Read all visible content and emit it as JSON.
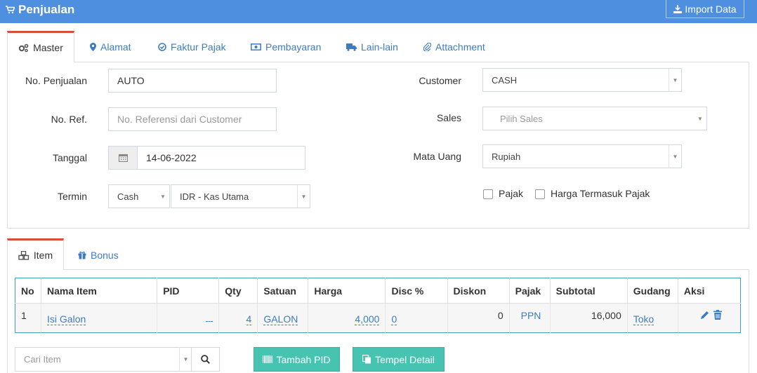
{
  "header": {
    "title": "Penjualan",
    "import_label": "Import Data"
  },
  "master_tabs": [
    "Master",
    "Alamat",
    "Faktur Pajak",
    "Pembayaran",
    "Lain-lain",
    "Attachment"
  ],
  "form": {
    "no_penjualan": {
      "label": "No. Penjualan",
      "value": "AUTO"
    },
    "no_ref": {
      "label": "No. Ref.",
      "placeholder": "No. Referensi dari Customer"
    },
    "tanggal": {
      "label": "Tanggal",
      "value": "14-06-2022"
    },
    "termin": {
      "label": "Termin",
      "value": "Cash",
      "account": "IDR - Kas Utama"
    },
    "customer": {
      "label": "Customer",
      "value": "CASH"
    },
    "sales": {
      "label": "Sales",
      "placeholder": "Pilih Sales"
    },
    "mata_uang": {
      "label": "Mata Uang",
      "value": "Rupiah"
    },
    "pajak_label": "Pajak",
    "harga_termasuk_pajak_label": "Harga Termasuk Pajak"
  },
  "item_tabs": [
    "Item",
    "Bonus"
  ],
  "table": {
    "headers": [
      "No",
      "Nama Item",
      "PID",
      "Qty",
      "Satuan",
      "Harga",
      "Disc %",
      "Diskon",
      "Pajak",
      "Subtotal",
      "Gudang",
      "Aksi"
    ],
    "rows": [
      {
        "no": "1",
        "nama_item": "Isi Galon",
        "pid": "",
        "qty": "4",
        "satuan": "GALON",
        "harga": "4,000",
        "disc": "0",
        "diskon": "0",
        "pajak": "PPN",
        "subtotal": "16,000",
        "gudang": "Toko"
      }
    ]
  },
  "search": {
    "placeholder": "Cari Item"
  },
  "buttons": {
    "tambah_pid": "Tambah PID",
    "tempel_detail": "Tempel Detail"
  },
  "colors": {
    "header_bg": "#4e8fe0",
    "accent_tab": "#dd4b39",
    "teal": "#46c3b1",
    "link": "#3c7cc3"
  }
}
